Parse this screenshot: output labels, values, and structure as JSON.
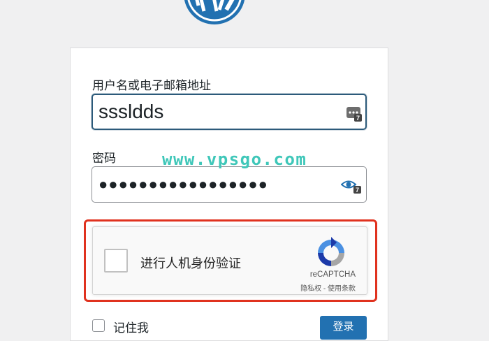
{
  "form": {
    "username_label": "用户名或电子邮箱地址",
    "username_value": "sssldds",
    "password_label": "密码",
    "password_masked": "●●●●●●●●●●●●●●●●●",
    "remember_label": "记住我",
    "login_button": "登录"
  },
  "captcha": {
    "prompt": "进行人机身份验证",
    "brand": "reCAPTCHA",
    "links": "隐私权 - 使用条款"
  },
  "watermark": "www.vpsgo.com",
  "colors": {
    "background": "#f0f0f1",
    "wp_logo": "#2271b1",
    "primary_button": "#2271b1",
    "highlight_frame": "#e0321f",
    "watermark": "#3fc7b9"
  }
}
